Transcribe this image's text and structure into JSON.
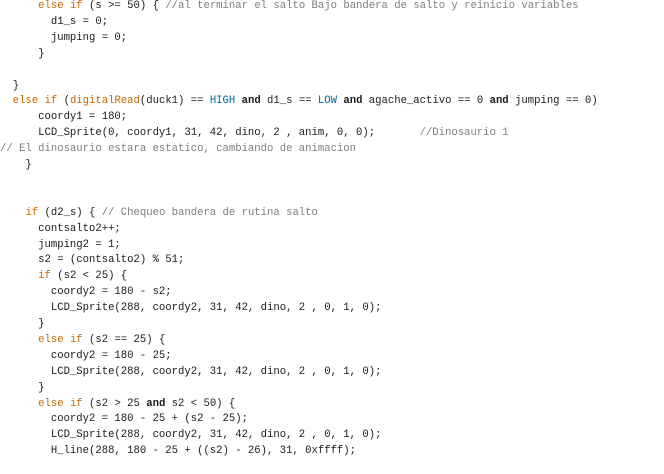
{
  "editor": {
    "lines": [
      [
        [
          "      ",
          ""
        ],
        [
          "else if",
          "kw"
        ],
        [
          " (s >= 50) { ",
          ""
        ],
        [
          "//al terminar el salto Bajo bandera de salto y reinicio variables",
          "cm"
        ]
      ],
      [
        [
          "        d1_s = 0;",
          ""
        ]
      ],
      [
        [
          "        jumping = 0;",
          ""
        ]
      ],
      [
        [
          "      }",
          ""
        ]
      ],
      [
        [
          "",
          ""
        ]
      ],
      [
        [
          "  }",
          ""
        ]
      ],
      [
        [
          "  ",
          ""
        ],
        [
          "else if",
          "kw"
        ],
        [
          " (",
          ""
        ],
        [
          "digitalRead",
          "fn"
        ],
        [
          "(duck1) == ",
          ""
        ],
        [
          "HIGH",
          "const"
        ],
        [
          " ",
          ""
        ],
        [
          "and",
          "b"
        ],
        [
          " d1_s == ",
          ""
        ],
        [
          "LOW",
          "const"
        ],
        [
          " ",
          ""
        ],
        [
          "and",
          "b"
        ],
        [
          " agache_activo == 0 ",
          ""
        ],
        [
          "and",
          "b"
        ],
        [
          " jumping == 0)",
          ""
        ]
      ],
      [
        [
          "      coordy1 = 180;",
          ""
        ]
      ],
      [
        [
          "      LCD_Sprite(0, coordy1, 31, 42, dino, 2 , anim, 0, 0);       ",
          ""
        ],
        [
          "//Dinosaurio 1",
          "cm"
        ]
      ],
      [
        [
          "// El dinosaurio estara estatico, cambiando de animacion",
          "cm"
        ]
      ],
      [
        [
          "    }",
          ""
        ]
      ],
      [
        [
          "",
          ""
        ]
      ],
      [
        [
          "",
          ""
        ]
      ],
      [
        [
          "    ",
          ""
        ],
        [
          "if",
          "kw"
        ],
        [
          " (d2_s) { ",
          ""
        ],
        [
          "// Chequeo bandera de rutina salto",
          "cm"
        ]
      ],
      [
        [
          "      contsalto2++;",
          ""
        ]
      ],
      [
        [
          "      jumping2 = 1;",
          ""
        ]
      ],
      [
        [
          "      s2 = (contsalto2) % 51;",
          ""
        ]
      ],
      [
        [
          "      ",
          ""
        ],
        [
          "if",
          "kw"
        ],
        [
          " (s2 < 25) {",
          ""
        ]
      ],
      [
        [
          "        coordy2 = 180 - s2;",
          ""
        ]
      ],
      [
        [
          "        LCD_Sprite(288, coordy2, 31, 42, dino, 2 , 0, 1, 0);",
          ""
        ]
      ],
      [
        [
          "      }",
          ""
        ]
      ],
      [
        [
          "      ",
          ""
        ],
        [
          "else if",
          "kw"
        ],
        [
          " (s2 == 25) {",
          ""
        ]
      ],
      [
        [
          "        coordy2 = 180 - 25;",
          ""
        ]
      ],
      [
        [
          "        LCD_Sprite(288, coordy2, 31, 42, dino, 2 , 0, 1, 0);",
          ""
        ]
      ],
      [
        [
          "      }",
          ""
        ]
      ],
      [
        [
          "      ",
          ""
        ],
        [
          "else if",
          "kw"
        ],
        [
          " (s2 > 25 ",
          ""
        ],
        [
          "and",
          "b"
        ],
        [
          " s2 < 50) {",
          ""
        ]
      ],
      [
        [
          "        coordy2 = 180 - 25 + (s2 - 25);",
          ""
        ]
      ],
      [
        [
          "        LCD_Sprite(288, coordy2, 31, 42, dino, 2 , 0, 1, 0);",
          ""
        ]
      ],
      [
        [
          "        H_line(288, 180 - 25 + ((s2) - 26), 31, 0xffff);",
          ""
        ]
      ]
    ]
  }
}
